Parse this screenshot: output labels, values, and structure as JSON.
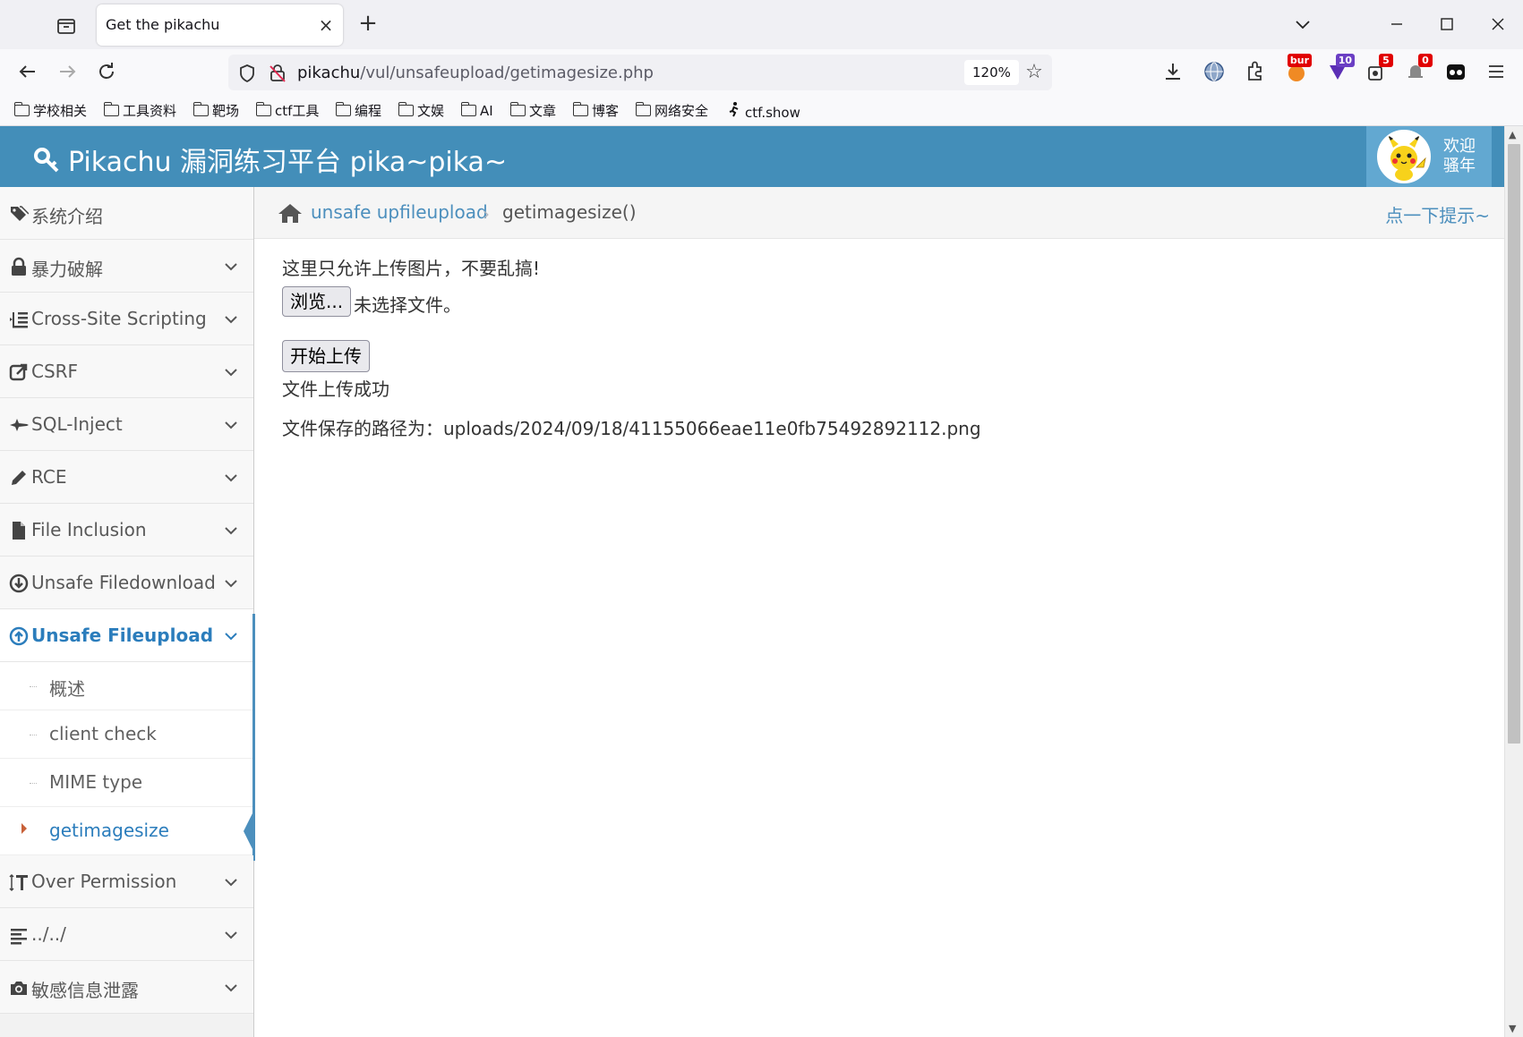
{
  "browser": {
    "tab_title": "Get the pikachu",
    "tab_close": "×",
    "new_tab": "+",
    "url_host": "pikachu",
    "url_path": "/vul/unsafeupload/getimagesize.php",
    "zoom": "120%",
    "ext_badges": {
      "burp": "bur",
      "ten": "10",
      "five": "5",
      "zero": "0"
    },
    "bookmarks": [
      "学校相关",
      "工具资料",
      "靶场",
      "ctf工具",
      "编程",
      "文娱",
      "AI",
      "文章",
      "博客",
      "网络安全",
      "ctf.show"
    ]
  },
  "header": {
    "brand": "Pikachu 漏洞练习平台 pika~pika~",
    "welcome": "欢迎骚年"
  },
  "sidebar": {
    "items": [
      {
        "label": "系统介绍"
      },
      {
        "label": "暴力破解"
      },
      {
        "label": "Cross-Site Scripting"
      },
      {
        "label": "CSRF"
      },
      {
        "label": "SQL-Inject"
      },
      {
        "label": "RCE"
      },
      {
        "label": "File Inclusion"
      },
      {
        "label": "Unsafe Filedownload"
      },
      {
        "label": "Unsafe Fileupload"
      },
      {
        "label": "Over Permission"
      },
      {
        "label": "../../"
      },
      {
        "label": "敏感信息泄露"
      }
    ],
    "submenu": [
      {
        "label": "概述"
      },
      {
        "label": "client check"
      },
      {
        "label": "MIME type"
      },
      {
        "label": "getimagesize"
      }
    ]
  },
  "breadcrumb": {
    "link": "unsafe upfileupload",
    "separator": "›",
    "current": "getimagesize()",
    "hint": "点一下提示~"
  },
  "content": {
    "notice": "这里只允许上传图片，不要乱搞!",
    "browse_label": "浏览...",
    "file_status": "未选择文件。",
    "upload_label": "开始上传",
    "success": "文件上传成功",
    "saved_path": "文件保存的路径为：uploads/2024/09/18/41155066eae11e0fb75492892112.png"
  },
  "colors": {
    "header": "#438eb9",
    "accent": "#2b7dbc",
    "link": "#4c8fbd"
  }
}
